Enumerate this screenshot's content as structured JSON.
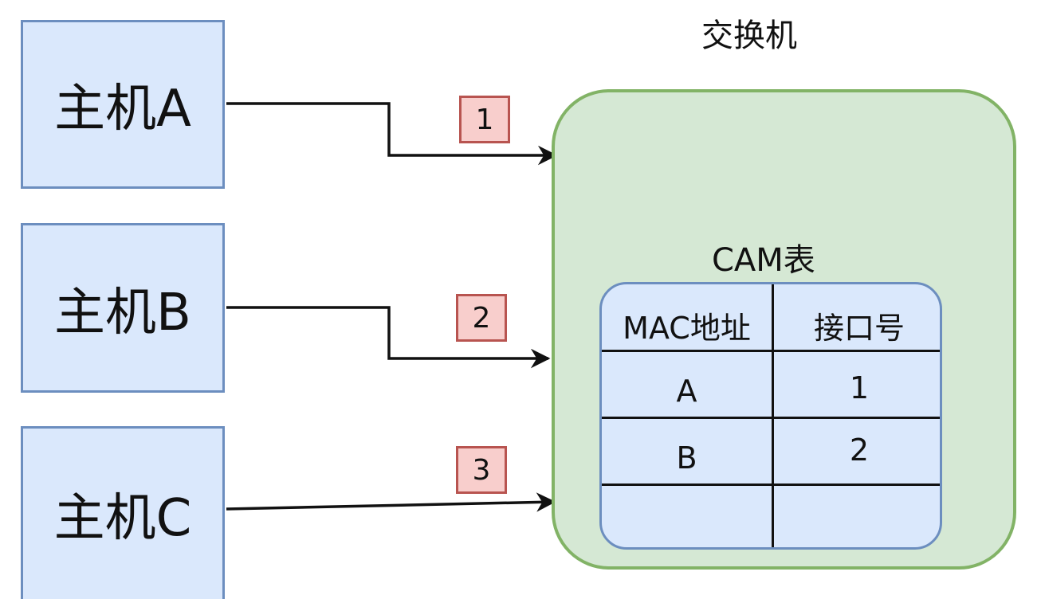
{
  "hosts": [
    {
      "label": "主机A"
    },
    {
      "label": "主机B"
    },
    {
      "label": "主机C"
    }
  ],
  "steps": [
    "1",
    "2",
    "3"
  ],
  "switch": {
    "title": "交换机",
    "cam_table": {
      "title": "CAM表",
      "headers": [
        "MAC地址",
        "接口号"
      ],
      "rows": [
        [
          "A",
          "1"
        ],
        [
          "B",
          "2"
        ],
        [
          "",
          ""
        ]
      ]
    }
  },
  "colors": {
    "host_fill": "#dae8fc",
    "host_border": "#6c8ebf",
    "switch_fill": "#d5e8d4",
    "switch_border": "#82b366",
    "badge_fill": "#f8cecc",
    "badge_border": "#b85450"
  }
}
